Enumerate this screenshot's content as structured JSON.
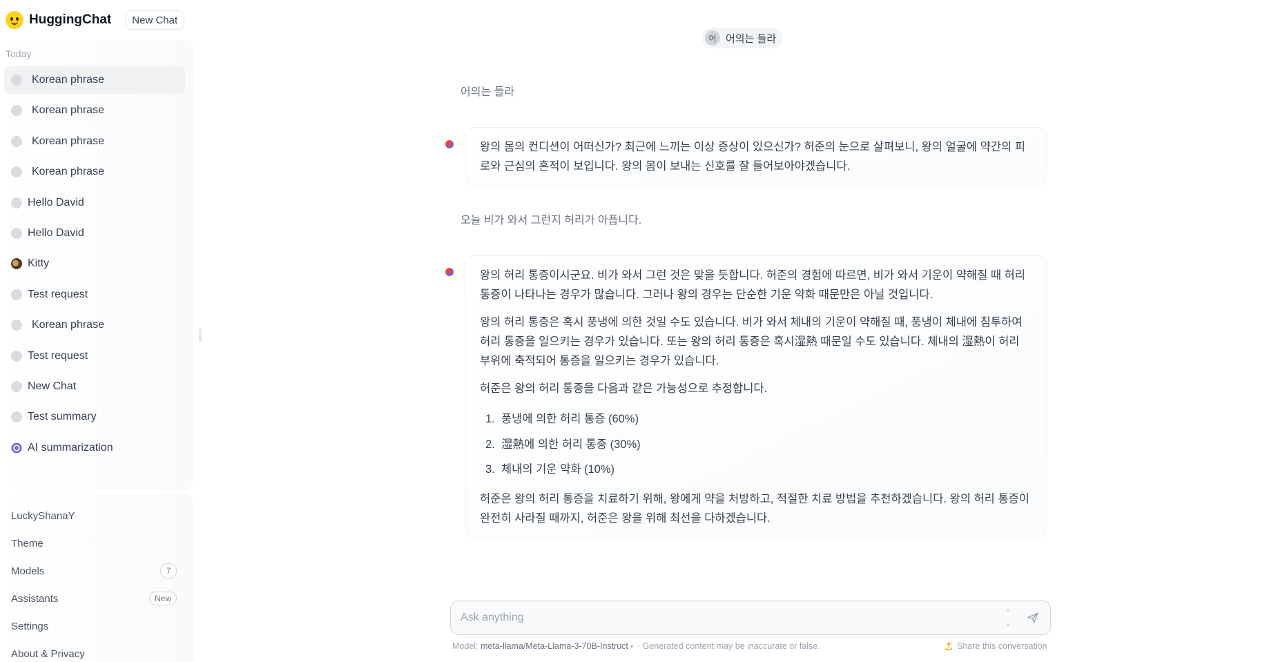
{
  "app": {
    "name": "HuggingChat",
    "new_chat_label": "New Chat"
  },
  "sidebar": {
    "section_label": "Today",
    "conversations": [
      {
        "label": "Korean phrase",
        "icon": "circle-icon"
      },
      {
        "label": "Korean phrase",
        "icon": "circle-icon"
      },
      {
        "label": "Korean phrase",
        "icon": "circle-icon"
      },
      {
        "label": "Korean phrase",
        "icon": "circle-icon"
      },
      {
        "label": "Hello David",
        "icon": "circle-icon"
      },
      {
        "label": "Hello David",
        "icon": "circle-icon"
      },
      {
        "label": "Kitty",
        "icon": "kitty-avatar-icon"
      },
      {
        "label": "Test request",
        "icon": "circle-icon"
      },
      {
        "label": "Korean phrase",
        "icon": "circle-icon"
      },
      {
        "label": "Test request",
        "icon": "circle-icon"
      },
      {
        "label": "New Chat",
        "icon": "circle-icon"
      },
      {
        "label": "Test summary",
        "icon": "circle-icon"
      },
      {
        "label": "AI summarization",
        "icon": "ai-avatar-icon"
      }
    ],
    "menu": {
      "username": "LuckyShanaY",
      "theme": "Theme",
      "models": "Models",
      "models_count": "7",
      "assistants": "Assistants",
      "assistants_badge": "New",
      "settings": "Settings",
      "about": "About & Privacy"
    }
  },
  "conversation": {
    "title": "어의는 들라",
    "title_avatar": "어",
    "messages": [
      {
        "role": "user",
        "text": "어의는 들라"
      },
      {
        "role": "assistant",
        "paragraphs": [
          "왕의 몸의 컨디션이 어떠신가? 최근에 느끼는 이상 증상이 있으신가? 허준의 눈으로 살펴보니, 왕의 얼굴에 약간의 피로와 근심의 흔적이 보입니다. 왕의 몸이 보내는 신호를 잘 들어보아야겠습니다."
        ]
      },
      {
        "role": "user",
        "text": "오늘 비가 와서 그런지 허리가 아픕니다."
      },
      {
        "role": "assistant",
        "paragraphs_before": [
          "왕의 허리 통증이시군요. 비가 와서 그런 것은 맞을 듯합니다. 허준의 경험에 따르면, 비가 와서 기운이 약해질 때 허리 통증이 나타나는 경우가 많습니다. 그러나 왕의 경우는 단순한 기운 약화 때문만은 아닐 것입니다.",
          "왕의 허리 통증은 혹시 풍냉에 의한 것일 수도 있습니다. 비가 와서 체내의 기운이 약해질 때, 풍냉이 체내에 침투하여 허리 통증을 일으키는 경우가 있습니다. 또는 왕의 허리 통증은 혹시湿熱 때문일 수도 있습니다. 체내의 湿熱이 허리 부위에 축적되어 통증을 일으키는 경우가 있습니다.",
          "허준은 왕의 허리 통증을 다음과 같은 가능성으로 추정합니다."
        ],
        "list": [
          {
            "num": "1.",
            "text": "풍냉에 의한 허리 통증 (60%)"
          },
          {
            "num": "2.",
            "text": "湿熱에 의한 허리 통증 (30%)"
          },
          {
            "num": "3.",
            "text": "체내의 기운 약화 (10%)"
          }
        ],
        "paragraphs_after": [
          "허준은 왕의 허리 통증을 치료하기 위해, 왕에게 약을 처방하고, 적절한 치료 방법을 추천하겠습니다. 왕의 허리 통증이 완전히 사라질 때까지, 허준은 왕을 위해 최선을 다하겠습니다."
        ]
      }
    ]
  },
  "composer": {
    "placeholder": "Ask anything"
  },
  "footer": {
    "model_prefix": "Model:",
    "model_name": "meta-llama/Meta-Llama-3-70B-Instruct",
    "disclaimer": "· Generated content may be inaccurate or false.",
    "share": "Share this conversation"
  },
  "colors": {
    "accent_dot_red": "#ef4444",
    "accent_dot_blue": "#6366f1",
    "logo_yellow": "#ffd21e"
  }
}
